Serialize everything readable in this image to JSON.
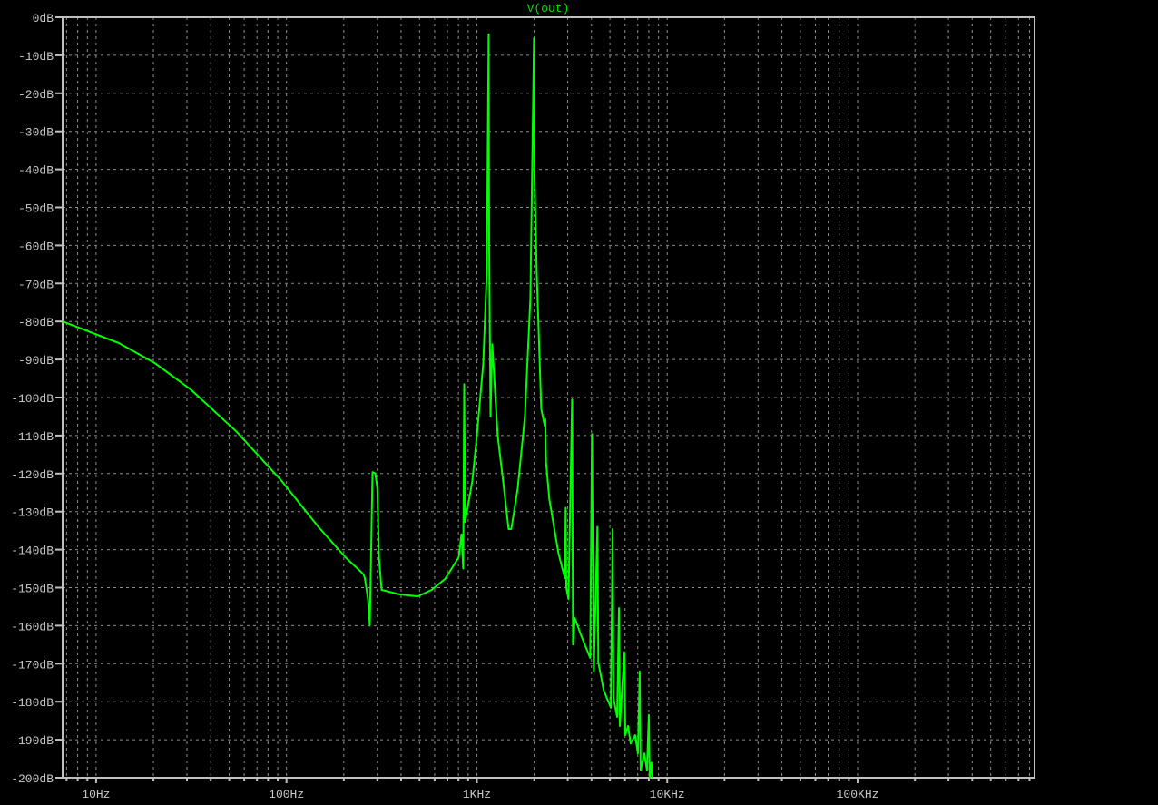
{
  "colors": {
    "background": "#000000",
    "grid": "#8c8c8c",
    "axis": "#c0c0c0",
    "trace": "#00ff00",
    "title": "#00e000"
  },
  "chart_data": {
    "type": "line",
    "title": "V(out)",
    "xlabel": "",
    "ylabel": "",
    "xscale": "log",
    "xlim": [
      6.67,
      850000
    ],
    "ylim": [
      -200,
      0
    ],
    "grid": true,
    "x_ticks": [
      {
        "value": 10,
        "label": "10Hz"
      },
      {
        "value": 100,
        "label": "100Hz"
      },
      {
        "value": 1000,
        "label": "1KHz"
      },
      {
        "value": 10000,
        "label": "10KHz"
      },
      {
        "value": 100000,
        "label": "100KHz"
      }
    ],
    "y_ticks": [
      {
        "value": 0,
        "label": "0dB"
      },
      {
        "value": -10,
        "label": "-10dB"
      },
      {
        "value": -20,
        "label": "-20dB"
      },
      {
        "value": -30,
        "label": "-30dB"
      },
      {
        "value": -40,
        "label": "-40dB"
      },
      {
        "value": -50,
        "label": "-50dB"
      },
      {
        "value": -60,
        "label": "-60dB"
      },
      {
        "value": -70,
        "label": "-70dB"
      },
      {
        "value": -80,
        "label": "-80dB"
      },
      {
        "value": -90,
        "label": "-90dB"
      },
      {
        "value": -100,
        "label": "-100dB"
      },
      {
        "value": -110,
        "label": "-110dB"
      },
      {
        "value": -120,
        "label": "-120dB"
      },
      {
        "value": -130,
        "label": "-130dB"
      },
      {
        "value": -140,
        "label": "-140dB"
      },
      {
        "value": -150,
        "label": "-150dB"
      },
      {
        "value": -160,
        "label": "-160dB"
      },
      {
        "value": -170,
        "label": "-170dB"
      },
      {
        "value": -180,
        "label": "-180dB"
      },
      {
        "value": -190,
        "label": "-190dB"
      },
      {
        "value": -200,
        "label": "-200dB"
      }
    ],
    "series": [
      {
        "name": "V(out)",
        "x": [
          6.67,
          13.2,
          20.4,
          31.6,
          54.7,
          94.6,
          147,
          204,
          254,
          258,
          268,
          274,
          283,
          293,
          300,
          306,
          316,
          394,
          490,
          578,
          681,
          803,
          830,
          848,
          858,
          868,
          946,
          1000,
          1080,
          1128,
          1153,
          1160,
          1179,
          1205,
          1287,
          1389,
          1468,
          1516,
          1637,
          1788,
          1909,
          1996,
          2005,
          2063,
          2178,
          2276,
          2290,
          2310,
          2403,
          2683,
          2898,
          2929,
          2950,
          3028,
          3163,
          3199,
          3270,
          3525,
          3936,
          4024,
          4113,
          4296,
          4343,
          4634,
          5054,
          5166,
          5222,
          5455,
          5575,
          5636,
          5952,
          6017,
          6218,
          6425,
          6786,
          7012,
          7167,
          7246,
          7570,
          7823,
          8000,
          8090,
          8260,
          8350
        ],
        "y": [
          -80,
          -85.7,
          -91,
          -98,
          -109,
          -122,
          -134,
          -142,
          -146.5,
          -147.5,
          -153,
          -160,
          -119.6,
          -120,
          -124,
          -142,
          -150.6,
          -151.8,
          -152.3,
          -150.6,
          -147.7,
          -142,
          -136,
          -145,
          -96.5,
          -132.7,
          -122,
          -110,
          -91,
          -67,
          -4.5,
          -60,
          -105,
          -86,
          -110,
          -124,
          -134.6,
          -134.6,
          -124,
          -105,
          -74,
          -5.5,
          -40,
          -67,
          -103,
          -107.6,
          -105.7,
          -117,
          -126.7,
          -141,
          -147.5,
          -129,
          -150,
          -153,
          -100.5,
          -165,
          -158,
          -162.5,
          -168.5,
          -109.6,
          -172,
          -134,
          -169.7,
          -177,
          -181.6,
          -134.6,
          -179,
          -184,
          -155.4,
          -186.4,
          -167,
          -188.8,
          -186.4,
          -191,
          -188.8,
          -193.6,
          -172,
          -198,
          -193.6,
          -198,
          -183.5,
          -200,
          -196,
          -200
        ]
      }
    ]
  }
}
